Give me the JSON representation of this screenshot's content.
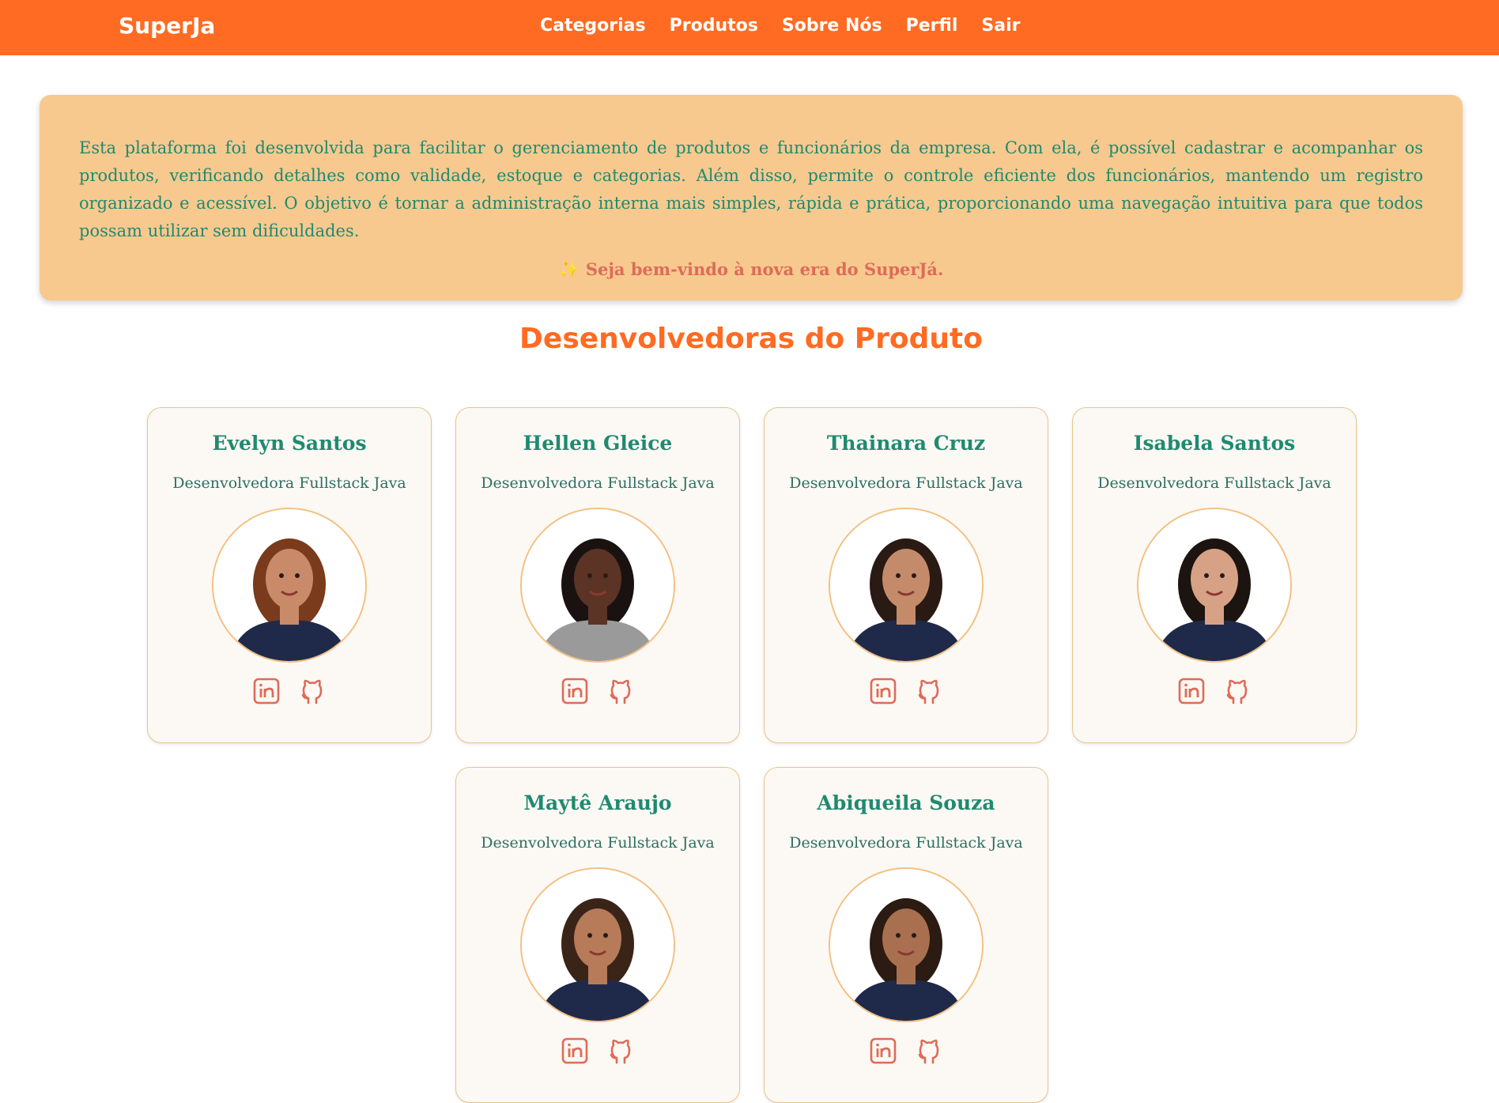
{
  "nav": {
    "brand": "SuperJa",
    "links": [
      "Categorias",
      "Produtos",
      "Sobre Nós",
      "Perfil",
      "Sair"
    ]
  },
  "about": {
    "text": "Esta plataforma foi desenvolvida para facilitar o gerenciamento de produtos e funcionários da empresa. Com ela, é possível cadastrar e acompanhar os produtos, verificando detalhes como validade, estoque e categorias. Além disso, permite o controle eficiente dos funcionários, mantendo um registro organizado e acessível. O objetivo é tornar a administração interna mais simples, rápida e prática, proporcionando uma navegação intuitiva para que todos possam utilizar sem dificuldades.",
    "welcome_icon": "✨",
    "welcome": "Seja bem-vindo à nova era do SuperJá."
  },
  "section_title": "Desenvolvedoras do Produto",
  "team": [
    {
      "name": "Evelyn Santos",
      "role": "Desenvolvedora Fullstack Java"
    },
    {
      "name": "Hellen Gleice",
      "role": "Desenvolvedora Fullstack Java"
    },
    {
      "name": "Thainara Cruz",
      "role": "Desenvolvedora Fullstack Java"
    },
    {
      "name": "Isabela Santos",
      "role": "Desenvolvedora Fullstack Java"
    },
    {
      "name": "Maytê Araujo",
      "role": "Desenvolvedora Fullstack Java"
    },
    {
      "name": "Abiqueila Souza",
      "role": "Desenvolvedora Fullstack Java"
    }
  ],
  "icons": {
    "linkedin": "linkedin-icon",
    "github": "github-icon"
  },
  "colors": {
    "navbar": "#ff6b22",
    "about_bg": "#f7c98e",
    "teal": "#1f8a70",
    "coral": "#de6b58",
    "card_border": "#e8c48a"
  }
}
